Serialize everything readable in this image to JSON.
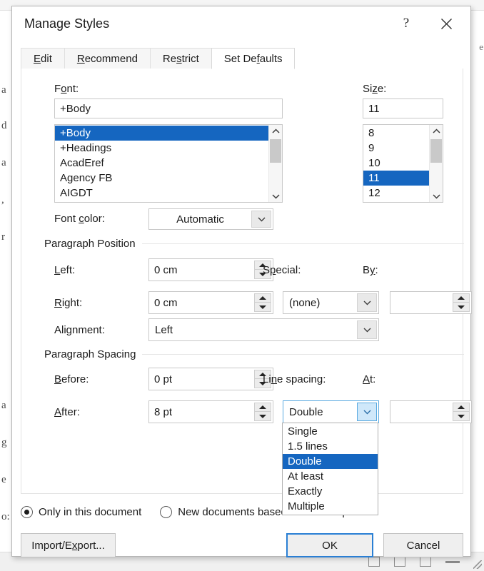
{
  "background": {
    "doc_lines": [
      "a",
      "d",
      "a",
      ",",
      "r",
      "a",
      "g",
      "e",
      "o:"
    ],
    "right_edge_text": "e"
  },
  "dialog": {
    "title": "Manage Styles",
    "help_icon": "question-mark-icon",
    "close_icon": "close-icon"
  },
  "tabs": [
    {
      "label": "Edit",
      "accel": "E",
      "active": false
    },
    {
      "label": "Recommend",
      "accel": "R",
      "active": false
    },
    {
      "label": "Restrict",
      "accel": "s",
      "active": false
    },
    {
      "label": "Set Defaults",
      "accel": "f",
      "active": true
    }
  ],
  "font_section": {
    "label": "Font:",
    "label_accel": "o",
    "value": "+Body",
    "options": [
      "+Body",
      "+Headings",
      "AcadEref",
      "Agency FB",
      "AIGDT"
    ],
    "selected": "+Body"
  },
  "size_section": {
    "label": "Size:",
    "label_accel": "z",
    "value": "11",
    "options": [
      "8",
      "9",
      "10",
      "11",
      "12"
    ],
    "selected": "11"
  },
  "font_color": {
    "label": "Font color:",
    "label_accel": "c",
    "value": "Automatic"
  },
  "paragraph_position": {
    "group_label": "Paragraph Position",
    "left": {
      "label": "Left:",
      "label_accel": "L",
      "value": "0 cm"
    },
    "right": {
      "label": "Right:",
      "label_accel": "R",
      "value": "0 cm"
    },
    "special": {
      "label": "Special:",
      "label_accel": "p",
      "value": "(none)"
    },
    "by": {
      "label": "By:",
      "label_accel": "y",
      "value": ""
    },
    "alignment": {
      "label": "Alignment:",
      "label_accel": "g",
      "value": "Left"
    }
  },
  "paragraph_spacing": {
    "group_label": "Paragraph Spacing",
    "before": {
      "label": "Before:",
      "label_accel": "B",
      "value": "0 pt"
    },
    "after": {
      "label": "After:",
      "label_accel": "A",
      "value": "8 pt"
    },
    "line_spacing": {
      "label": "Line spacing:",
      "label_accel": "n",
      "value": "Double",
      "open": true,
      "options": [
        "Single",
        "1.5 lines",
        "Double",
        "At least",
        "Exactly",
        "Multiple"
      ],
      "selected": "Double"
    },
    "at": {
      "label": "At:",
      "label_accel": "A",
      "value": ""
    }
  },
  "scope": {
    "only_this_document": {
      "label": "Only in this document",
      "checked": true
    },
    "new_documents": {
      "label": "New documents based on this template",
      "checked": false
    }
  },
  "buttons": {
    "import_export": {
      "label": "Import/Export...",
      "accel": "x"
    },
    "ok": {
      "label": "OK",
      "focused": true
    },
    "cancel": {
      "label": "Cancel",
      "focused": false
    }
  },
  "colors": {
    "selection_blue": "#1566c0",
    "focus_blue": "#2a7fd4",
    "hover_blue": "#cfe8fa",
    "dialog_bg": "#ffffff",
    "control_gray": "#efefef"
  }
}
